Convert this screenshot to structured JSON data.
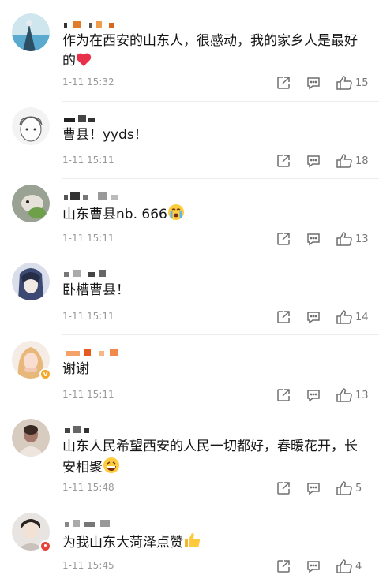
{
  "comments": [
    {
      "text": "作为在西安的山东人，很感动，我的家乡人是最好的",
      "emoji": "heart",
      "time": "1-11 15:32",
      "likes": "15",
      "avatar": "landscape-avatar",
      "accent": "#3aa6d8"
    },
    {
      "text": "曹县！yyds！",
      "emoji": "",
      "time": "1-11 15:11",
      "likes": "18",
      "avatar": "anime-boy-avatar",
      "accent": "#9aa0a6"
    },
    {
      "text": "山东曹县nb. 666",
      "emoji": "crying-face",
      "time": "1-11 15:11",
      "likes": "13",
      "avatar": "pet-avatar",
      "accent": "#6ea04a"
    },
    {
      "text": "卧槽曹县！",
      "emoji": "",
      "time": "1-11 15:11",
      "likes": "14",
      "avatar": "dark-anime-avatar",
      "accent": "#3c4a73"
    },
    {
      "text": "谢谢",
      "emoji": "",
      "time": "1-11 15:11",
      "likes": "13",
      "avatar": "girl-avatar",
      "accent": "#e8b77a",
      "badge": "verified-badge-gold"
    },
    {
      "text": "山东人民希望西安的人民一切都好，春暖花开，长安相聚",
      "emoji": "grinning-face",
      "time": "1-11 15:48",
      "likes": "5",
      "avatar": "photo-avatar",
      "accent": "#a3776a"
    },
    {
      "text": "为我山东大菏泽点赞",
      "emoji": "thumbs-up",
      "time": "1-11 15:45",
      "likes": "4",
      "avatar": "portrait-avatar",
      "accent": "#c9c1bc",
      "badge": "red-badge"
    }
  ],
  "icons": {
    "repost": "repost-icon",
    "comment": "comment-icon",
    "like": "thumbs-up-icon"
  },
  "colors": {
    "text": "#161616",
    "meta": "#9a9a9a",
    "heart": "#e8304a",
    "gold_badge": "#f5a623",
    "red_badge": "#e8403a"
  }
}
